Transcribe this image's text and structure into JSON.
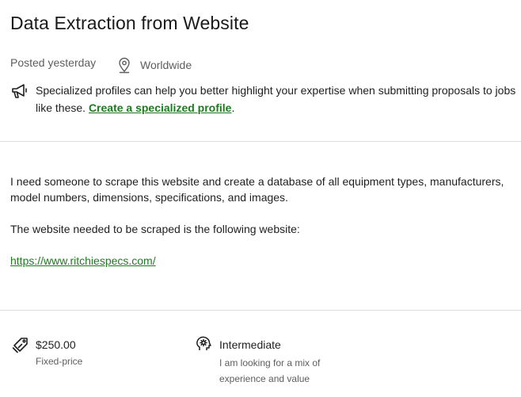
{
  "job": {
    "title": "Data Extraction from Website",
    "posted": "Posted yesterday",
    "location": "Worldwide"
  },
  "promo": {
    "text": "Specialized profiles can help you better highlight your expertise when submitting proposals to jobs like these. ",
    "link_label": "Create a specialized profile",
    "suffix": "."
  },
  "description": {
    "paragraph1": "I need someone to scrape this website and create a database of all equipment types, manufacturers, model numbers, dimensions, specifications, and images.",
    "paragraph2": "The website needed to be scraped is the following website:",
    "url": "https://www.ritchiespecs.com/"
  },
  "budget": {
    "amount": "$250.00",
    "type": "Fixed-price"
  },
  "experience": {
    "level": "Intermediate",
    "description": "I am looking for a mix of experience and value"
  },
  "icons": {
    "location": "map-pin-icon",
    "promo": "megaphone-icon",
    "budget": "price-tag-icon",
    "experience": "gear-brain-icon"
  },
  "colors": {
    "link_green": "#1e7a1e",
    "muted_text": "#5e5e5e",
    "divider": "#dcdcdc"
  }
}
